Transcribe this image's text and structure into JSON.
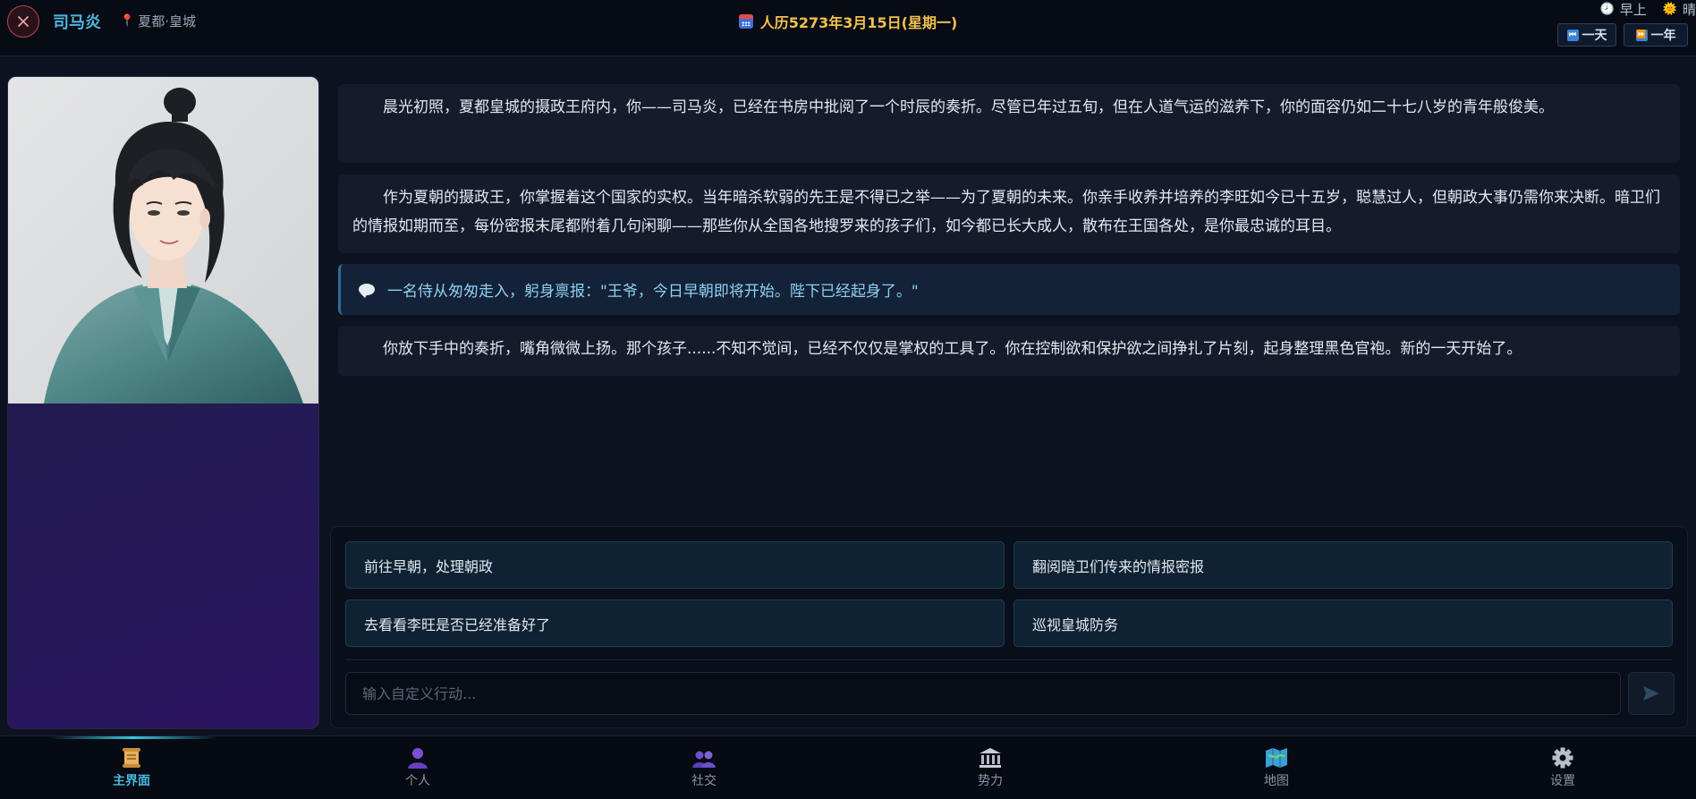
{
  "header": {
    "character_name": "司马炎",
    "location": "夏都·皇城",
    "date": "人历5273年3月15日(星期一)",
    "time_of_day": "早上",
    "weather": "晴",
    "skip_day_label": "一天",
    "skip_year_label": "一年"
  },
  "narrative": {
    "paragraphs": [
      "晨光初照，夏都皇城的摄政王府内，你——司马炎，已经在书房中批阅了一个时辰的奏折。尽管已年过五旬，但在人道气运的滋养下，你的面容仍如二十七八岁的青年般俊美。",
      "作为夏朝的摄政王，你掌握着这个国家的实权。当年暗杀软弱的先王是不得已之举——为了夏朝的未来。你亲手收养并培养的李旺如今已十五岁，聪慧过人，但朝政大事仍需你来决断。暗卫们的情报如期而至，每份密报末尾都附着几句闲聊——那些你从全国各地搜罗来的孩子们，如今都已长大成人，散布在王国各处，是你最忠诚的耳目。",
      "你放下手中的奏折，嘴角微微上扬。那个孩子......不知不觉间，已经不仅仅是掌权的工具了。你在控制欲和保护欲之间挣扎了片刻，起身整理黑色官袍。新的一天开始了。"
    ],
    "dialogue": "一名侍从匆匆走入，躬身禀报：\"王爷，今日早朝即将开始。陛下已经起身了。\""
  },
  "choices": [
    "前往早朝，处理朝政",
    "翻阅暗卫们传来的情报密报",
    "去看看李旺是否已经准备好了",
    "巡视皇城防务"
  ],
  "input": {
    "placeholder": "输入自定义行动...",
    "value": ""
  },
  "nav": [
    {
      "label": "主界面",
      "icon": "scroll-icon",
      "active": true
    },
    {
      "label": "个人",
      "icon": "person-icon",
      "active": false
    },
    {
      "label": "社交",
      "icon": "people-icon",
      "active": false
    },
    {
      "label": "势力",
      "icon": "bank-icon",
      "active": false
    },
    {
      "label": "地图",
      "icon": "map-icon",
      "active": false
    },
    {
      "label": "设置",
      "icon": "gear-icon",
      "active": false
    }
  ],
  "colors": {
    "accent": "#4fb8e0",
    "date": "#f2c14e",
    "dialogue": "#8fd0f5",
    "close": "#b8454f"
  }
}
